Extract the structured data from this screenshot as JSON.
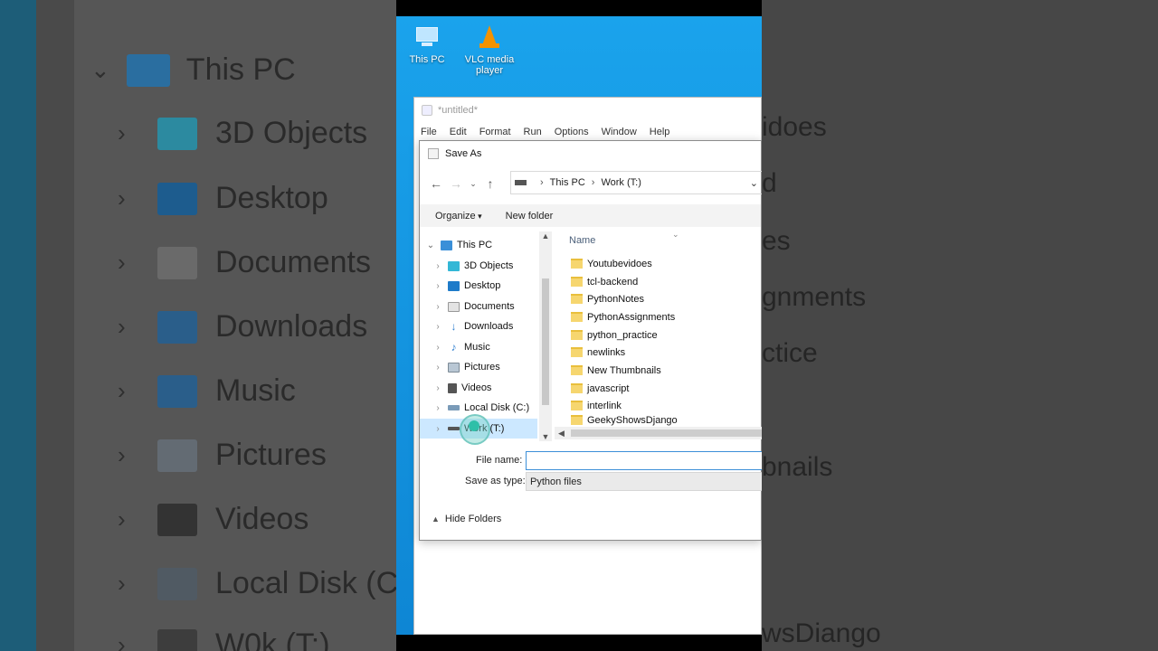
{
  "desktop": {
    "icons": [
      {
        "label": "This PC",
        "icon": "this-pc-icon"
      },
      {
        "label": "VLC media player",
        "icon": "vlc-icon"
      }
    ]
  },
  "idle": {
    "title": "*untitled*",
    "menu": [
      "File",
      "Edit",
      "Format",
      "Run",
      "Options",
      "Window",
      "Help"
    ]
  },
  "dialog": {
    "title": "Save As",
    "breadcrumb": [
      "This PC",
      "Work (T:)"
    ],
    "toolbar": {
      "organize": "Organize",
      "new_folder": "New folder"
    },
    "tree": [
      {
        "label": "This PC",
        "color": "#3a8fd8"
      },
      {
        "label": "3D Objects",
        "color": "#33b7d6"
      },
      {
        "label": "Desktop",
        "color": "#1e7bc9"
      },
      {
        "label": "Documents",
        "color": "#d8d8d8"
      },
      {
        "label": "Downloads",
        "color": "#2f7fd0"
      },
      {
        "label": "Music",
        "color": "#2f7fd0"
      },
      {
        "label": "Pictures",
        "color": "#b9c7d4"
      },
      {
        "label": "Videos",
        "color": "#555555"
      },
      {
        "label": "Local Disk (C:)",
        "color": "#7a9bb8"
      },
      {
        "label": "Work (T:)",
        "color": "#555555"
      }
    ],
    "column_name": "Name",
    "files": [
      "Youtubevidoes",
      "tcl-backend",
      "PythonNotes",
      "PythonAssignments",
      "python_practice",
      "newlinks",
      "New Thumbnails",
      "javascript",
      "interlink",
      "GeekyShowsDjango"
    ],
    "file_name_label": "File name:",
    "file_name_value": "",
    "save_type_label": "Save as type:",
    "save_type_value": "Python files",
    "hide_folders": "Hide Folders"
  },
  "background": {
    "title": "This PC",
    "left_items": [
      "3D Objects",
      "Desktop",
      "Documents",
      "Downloads",
      "Music",
      "Pictures",
      "Videos",
      "Local Disk (C",
      "W0k (T:)"
    ],
    "right_items": [
      "idoes",
      "d",
      "es",
      "gnments",
      "ctice",
      "bnails",
      "wsDiango"
    ]
  }
}
